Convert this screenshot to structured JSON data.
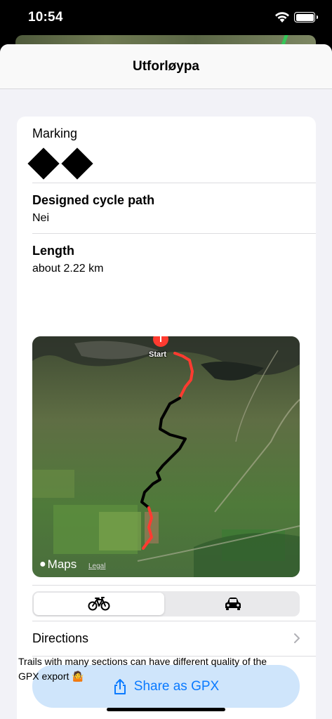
{
  "status_bar": {
    "time": "10:54"
  },
  "nav": {
    "title": "Utforløypa"
  },
  "marking": {
    "label": "Marking",
    "icon": "double-black-diamond"
  },
  "designed_path": {
    "label": "Designed cycle path",
    "value": "Nei"
  },
  "length": {
    "label": "Length",
    "value": "about 2.22 km"
  },
  "map": {
    "start_label": "Start",
    "maps_brand": "Maps",
    "legal": "Legal"
  },
  "transport_mode": {
    "options": [
      "bicycle",
      "car"
    ],
    "selected": "bicycle"
  },
  "directions": {
    "label": "Directions"
  },
  "share": {
    "label": "Share as GPX"
  },
  "footnote": {
    "text": "Trails with many sections can have different quality of the GPX export 🤷"
  },
  "colors": {
    "accent": "#0a7aff",
    "button_bg": "#cfe5fb",
    "route_red": "#ff3b30",
    "route_black": "#000000"
  }
}
